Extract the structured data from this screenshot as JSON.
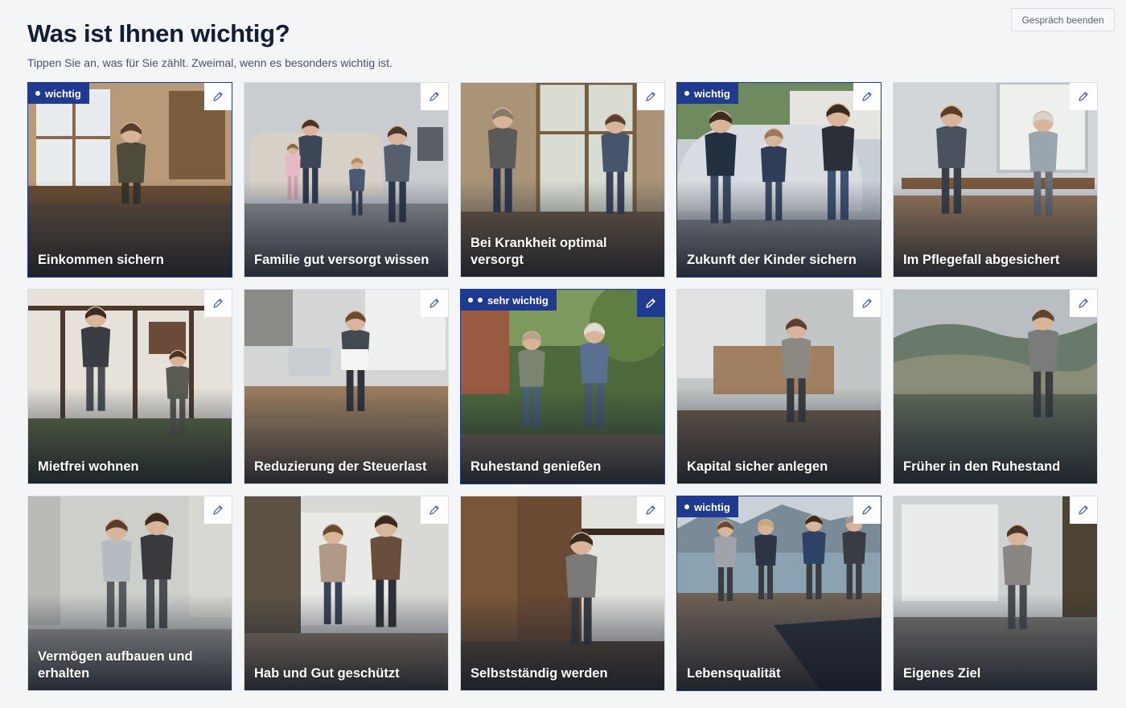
{
  "header": {
    "title": "Was ist Ihnen wichtig?",
    "subtitle": "Tippen Sie an, was für Sie zählt. Zweimal, wenn es besonders wichtig ist.",
    "end_button": "Gespräch beenden"
  },
  "colors": {
    "accent": "#1f3a8f",
    "background": "#f4f5f7"
  },
  "tiles": [
    {
      "label": "Einkommen sichern",
      "badge": "wichtig",
      "level": 1,
      "scene": "workshop"
    },
    {
      "label": "Familie gut versorgt wissen",
      "badge": "",
      "level": 0,
      "scene": "livingroom"
    },
    {
      "label": "Bei Krankheit optimal versorgt",
      "badge": "",
      "level": 0,
      "scene": "window"
    },
    {
      "label": "Zukunft der Kinder sichern",
      "badge": "wichtig",
      "level": 1,
      "scene": "street"
    },
    {
      "label": "Im Pflegefall abgesichert",
      "badge": "",
      "level": 0,
      "scene": "kitchen"
    },
    {
      "label": "Mietfrei wohnen",
      "badge": "",
      "level": 0,
      "scene": "house"
    },
    {
      "label": "Reduzierung der Steuerlast",
      "badge": "",
      "level": 0,
      "scene": "desk"
    },
    {
      "label": "Ruhestand genießen",
      "badge": "sehr wichtig",
      "level": 2,
      "scene": "garden"
    },
    {
      "label": "Kapital sicher anlegen",
      "badge": "",
      "level": 0,
      "scene": "table"
    },
    {
      "label": "Früher in den Ruhestand",
      "badge": "",
      "level": 0,
      "scene": "landscape"
    },
    {
      "label": "Vermögen aufbauen und erhalten",
      "badge": "",
      "level": 0,
      "scene": "renovation"
    },
    {
      "label": "Hab und Gut geschützt",
      "badge": "",
      "level": 0,
      "scene": "hallway"
    },
    {
      "label": "Selbstständig werden",
      "badge": "",
      "level": 0,
      "scene": "door"
    },
    {
      "label": "Lebensqualität",
      "badge": "wichtig",
      "level": 1,
      "scene": "lake"
    },
    {
      "label": "Eigenes Ziel",
      "badge": "",
      "level": 0,
      "scene": "study"
    }
  ]
}
